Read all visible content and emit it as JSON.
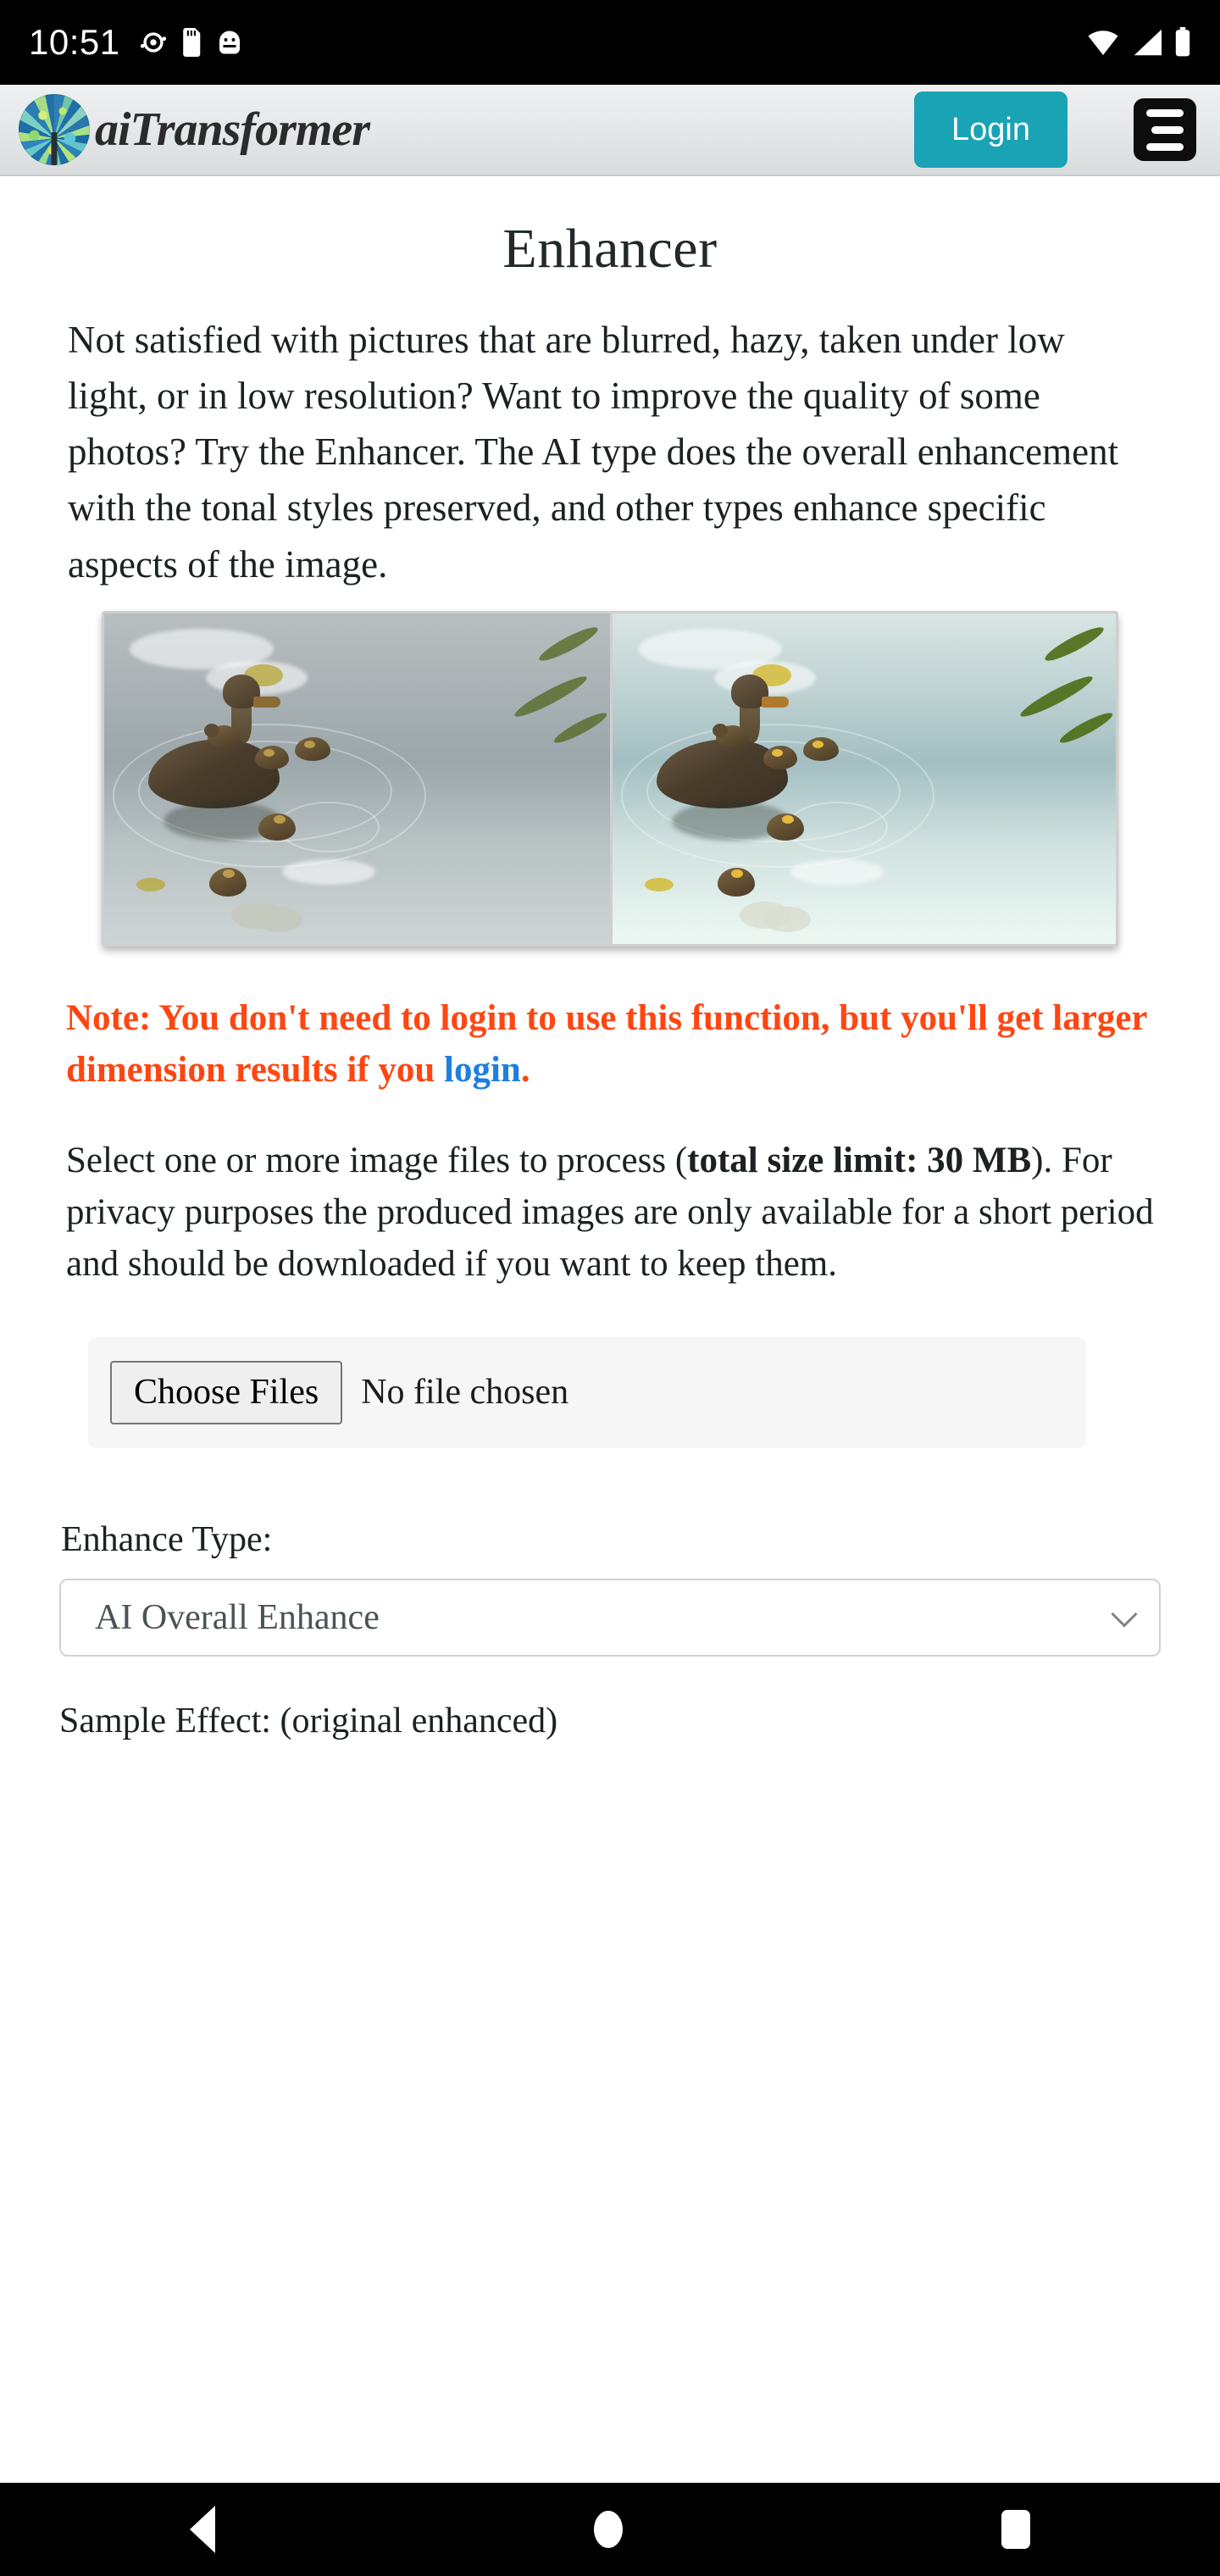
{
  "status_bar": {
    "time": "10:51",
    "left_icons": [
      "record-icon",
      "sd-card-icon",
      "usb-debug-icon"
    ],
    "right_icons": [
      "wifi-icon",
      "cellular-signal-icon",
      "battery-icon"
    ]
  },
  "header": {
    "logo_alt": "aiTransformer tree logo",
    "brand_name": "aiTransformer",
    "login_label": "Login",
    "menu_label": "Menu"
  },
  "main": {
    "title": "Enhancer",
    "intro": "Not satisfied with pictures that are blurred, hazy, taken under low light, or in low resolution? Want to improve the quality of some photos? Try the Enhancer. The AI type does the overall enhancement with the tonal styles preserved, and other types enhance specific aspects of the image.",
    "sample_image": {
      "alt": "Before and after comparison of a duck with ducklings swimming",
      "left_caption": "original",
      "right_caption": "enhanced"
    },
    "note": {
      "text_before_link": "Note: You don't need to login to use this function, but you'll get larger dimension results if you ",
      "link_label": "login",
      "text_after_link": "."
    },
    "description": {
      "part1": "Select one or more image files to process (",
      "bold": "total size limit: 30 MB",
      "part2": "). For privacy purposes the produced images are only available for a short period and should be downloaded if you want to keep them."
    },
    "file_input": {
      "button_label": "Choose Files",
      "status": "No file chosen"
    },
    "enhance_type": {
      "label": "Enhance Type:",
      "selected": "AI Overall Enhance",
      "chevron": "chevron-down-icon"
    },
    "sample_effect_label": "Sample Effect: (original enhanced)"
  },
  "nav_bar": {
    "back": "back-icon",
    "home": "home-icon",
    "recents": "recents-icon"
  },
  "colors": {
    "accent_teal": "#19a3b5",
    "note_orange": "#ff4612",
    "link_blue": "#1f7fe0"
  }
}
